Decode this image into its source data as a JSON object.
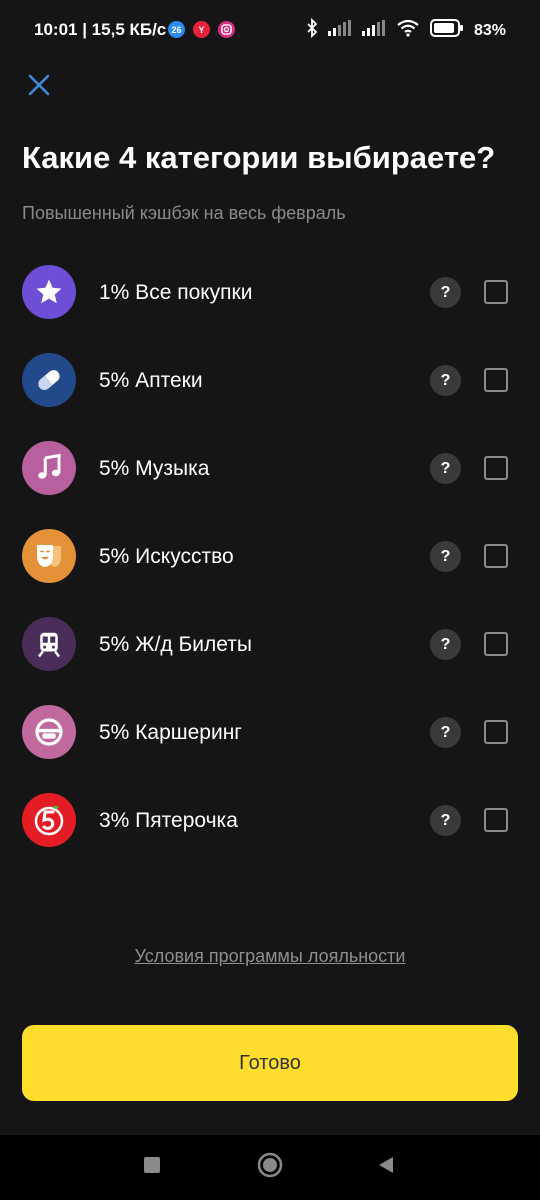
{
  "status": {
    "time": "10:01 | 15,5 КБ/с",
    "notif_icons": [
      {
        "name": "notif-26-icon",
        "text": "26",
        "color": "#2a8cf0"
      },
      {
        "name": "notif-yandex-icon",
        "text": "Y",
        "color": "#e8213a"
      },
      {
        "name": "notif-instagram-icon",
        "text": "",
        "color": "#d62f7f"
      }
    ],
    "battery": "83%"
  },
  "header": {
    "title": "Какие 4 категории выбираете?",
    "subtitle": "Повышенный кэшбэк на весь февраль"
  },
  "categories": [
    {
      "label": "1% Все покупки",
      "icon": "star-icon",
      "color": "#6c4fd4",
      "checked": false
    },
    {
      "label": "5% Аптеки",
      "icon": "pill-icon",
      "color": "#22498a",
      "checked": false
    },
    {
      "label": "5% Музыка",
      "icon": "music-note-icon",
      "color": "#b8609e",
      "checked": false
    },
    {
      "label": "5% Искусство",
      "icon": "theatre-mask-icon",
      "color": "#e39238",
      "checked": false
    },
    {
      "label": "5% Ж/д Билеты",
      "icon": "train-icon",
      "color": "#4a2d59",
      "checked": false
    },
    {
      "label": "5% Каршеринг",
      "icon": "steering-wheel-icon",
      "color": "#c0699e",
      "checked": false
    },
    {
      "label": "3% Пятерочка",
      "icon": "pyaterochka-logo-icon",
      "color": "#e41d24",
      "checked": false
    }
  ],
  "help_label": "?",
  "footer": {
    "loyalty_link": "Условия программы лояльности",
    "done_button": "Готово"
  },
  "colors": {
    "accent": "#ffdd2d",
    "background": "#151515"
  }
}
